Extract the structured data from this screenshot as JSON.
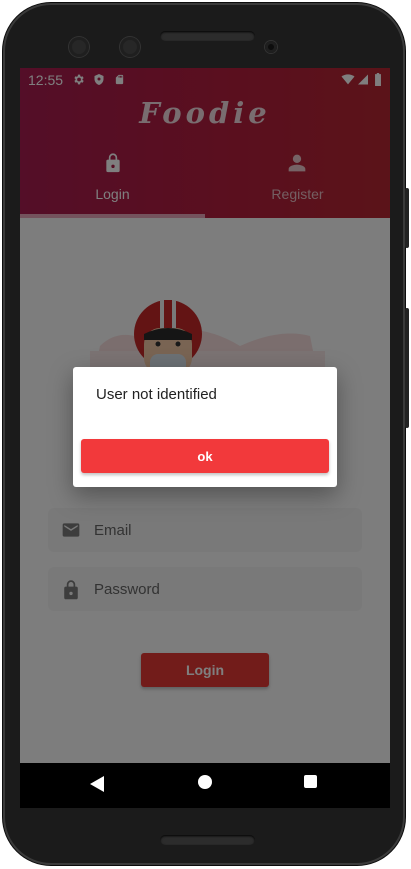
{
  "statusbar": {
    "time": "12:55",
    "icons": [
      "gear-icon",
      "shield-icon",
      "sd-card-icon",
      "wifi-icon",
      "signal-icon",
      "battery-icon"
    ]
  },
  "app": {
    "title": "Foodie",
    "brand_color": "#b41e3e",
    "accent_color": "#e53935"
  },
  "tabs": [
    {
      "label": "Login",
      "icon": "lock-icon",
      "selected": true
    },
    {
      "label": "Register",
      "icon": "person-icon",
      "selected": false
    }
  ],
  "form": {
    "email_placeholder": "Email",
    "email_icon": "mail-icon",
    "password_placeholder": "Password",
    "password_icon": "lock-icon",
    "login_label": "Login"
  },
  "dialog": {
    "message": "User not identified",
    "ok_label": "ok"
  },
  "navbar": {
    "icons": [
      "back-icon",
      "home-icon",
      "recents-icon"
    ]
  }
}
